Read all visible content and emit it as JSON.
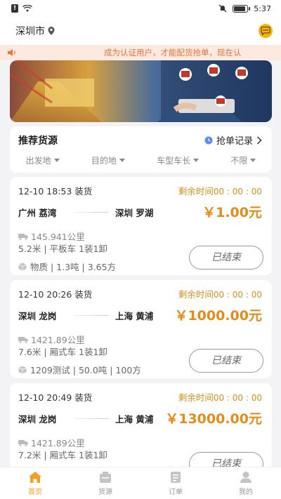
{
  "status_bar": {
    "time": "5:37",
    "battery_level": 0.85
  },
  "header": {
    "city": "深圳市"
  },
  "notice": {
    "text": "成为认证用户，才能配货抢单，现在认"
  },
  "section": {
    "title": "推荐货源",
    "grab_records_label": "抢单记录"
  },
  "filters": [
    {
      "label": "出发地"
    },
    {
      "label": "目的地"
    },
    {
      "label": "车型车长"
    },
    {
      "label": "不限"
    }
  ],
  "cards": [
    {
      "load_time": "12-10 18:53 装货",
      "remaining_label": "剩余时间",
      "remaining_value": "00 : 00 : 00",
      "from": "广州 荔湾",
      "to": "深圳 罗湖",
      "price": "￥1.00元",
      "distance": "145.941公里",
      "truck": "5.2米 | 平板车 1装1卸",
      "goods": "物质 | 1.3吨 | 3.65方",
      "status_button": "已结束"
    },
    {
      "load_time": "12-10 20:26 装货",
      "remaining_label": "剩余时间",
      "remaining_value": "00 : 00 : 00",
      "from": "深圳 龙岗",
      "to": "上海 黄浦",
      "price": "￥1000.00元",
      "distance": "1421.89公里",
      "truck": "7.6米 | 厢式车 1装1卸",
      "goods": "1209测试 | 50.0吨 | 100方",
      "status_button": "已结束"
    },
    {
      "load_time": "12-10 20:49 装货",
      "remaining_label": "剩余时间",
      "remaining_value": "00 : 00 : 00",
      "from": "深圳 龙岗",
      "to": "上海 黄浦",
      "price": "￥13000.00元",
      "distance": "1421.89公里",
      "truck": "7.2米 | 厢式车 1装1卸",
      "goods": "",
      "status_button": "已结束"
    }
  ],
  "tabbar": [
    {
      "label": "首页",
      "icon": "home-icon",
      "active": true
    },
    {
      "label": "货源",
      "icon": "cargo-icon",
      "active": false
    },
    {
      "label": "订单",
      "icon": "order-icon",
      "active": false
    },
    {
      "label": "我的",
      "icon": "profile-icon",
      "active": false
    }
  ],
  "colors": {
    "accent": "#f0a020",
    "price": "#e38c1c",
    "notice_bg": "#fde9df",
    "notice_text": "#e8743b"
  }
}
